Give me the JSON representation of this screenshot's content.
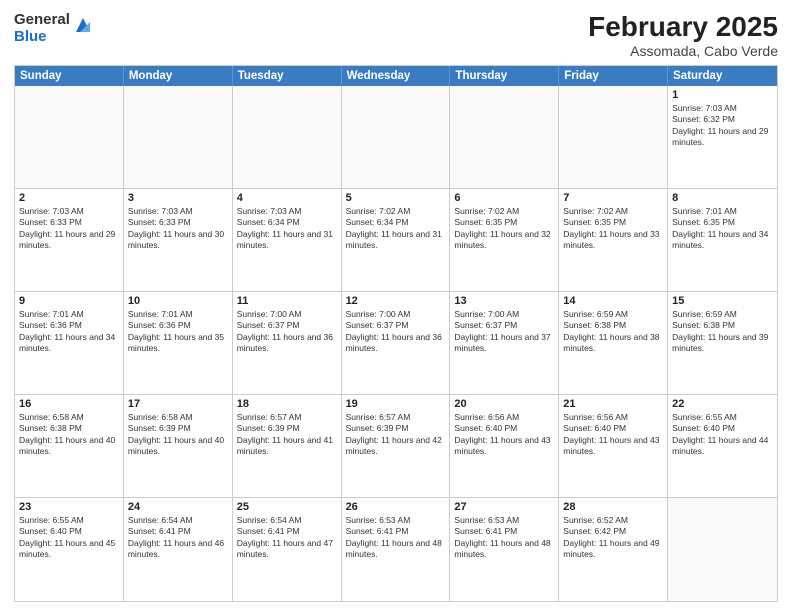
{
  "logo": {
    "general": "General",
    "blue": "Blue"
  },
  "title": "February 2025",
  "location": "Assomada, Cabo Verde",
  "header_days": [
    "Sunday",
    "Monday",
    "Tuesday",
    "Wednesday",
    "Thursday",
    "Friday",
    "Saturday"
  ],
  "weeks": [
    [
      {
        "day": "",
        "text": ""
      },
      {
        "day": "",
        "text": ""
      },
      {
        "day": "",
        "text": ""
      },
      {
        "day": "",
        "text": ""
      },
      {
        "day": "",
        "text": ""
      },
      {
        "day": "",
        "text": ""
      },
      {
        "day": "1",
        "text": "Sunrise: 7:03 AM\nSunset: 6:32 PM\nDaylight: 11 hours and 29 minutes."
      }
    ],
    [
      {
        "day": "2",
        "text": "Sunrise: 7:03 AM\nSunset: 6:33 PM\nDaylight: 11 hours and 29 minutes."
      },
      {
        "day": "3",
        "text": "Sunrise: 7:03 AM\nSunset: 6:33 PM\nDaylight: 11 hours and 30 minutes."
      },
      {
        "day": "4",
        "text": "Sunrise: 7:03 AM\nSunset: 6:34 PM\nDaylight: 11 hours and 31 minutes."
      },
      {
        "day": "5",
        "text": "Sunrise: 7:02 AM\nSunset: 6:34 PM\nDaylight: 11 hours and 31 minutes."
      },
      {
        "day": "6",
        "text": "Sunrise: 7:02 AM\nSunset: 6:35 PM\nDaylight: 11 hours and 32 minutes."
      },
      {
        "day": "7",
        "text": "Sunrise: 7:02 AM\nSunset: 6:35 PM\nDaylight: 11 hours and 33 minutes."
      },
      {
        "day": "8",
        "text": "Sunrise: 7:01 AM\nSunset: 6:35 PM\nDaylight: 11 hours and 34 minutes."
      }
    ],
    [
      {
        "day": "9",
        "text": "Sunrise: 7:01 AM\nSunset: 6:36 PM\nDaylight: 11 hours and 34 minutes."
      },
      {
        "day": "10",
        "text": "Sunrise: 7:01 AM\nSunset: 6:36 PM\nDaylight: 11 hours and 35 minutes."
      },
      {
        "day": "11",
        "text": "Sunrise: 7:00 AM\nSunset: 6:37 PM\nDaylight: 11 hours and 36 minutes."
      },
      {
        "day": "12",
        "text": "Sunrise: 7:00 AM\nSunset: 6:37 PM\nDaylight: 11 hours and 36 minutes."
      },
      {
        "day": "13",
        "text": "Sunrise: 7:00 AM\nSunset: 6:37 PM\nDaylight: 11 hours and 37 minutes."
      },
      {
        "day": "14",
        "text": "Sunrise: 6:59 AM\nSunset: 6:38 PM\nDaylight: 11 hours and 38 minutes."
      },
      {
        "day": "15",
        "text": "Sunrise: 6:59 AM\nSunset: 6:38 PM\nDaylight: 11 hours and 39 minutes."
      }
    ],
    [
      {
        "day": "16",
        "text": "Sunrise: 6:58 AM\nSunset: 6:38 PM\nDaylight: 11 hours and 40 minutes."
      },
      {
        "day": "17",
        "text": "Sunrise: 6:58 AM\nSunset: 6:39 PM\nDaylight: 11 hours and 40 minutes."
      },
      {
        "day": "18",
        "text": "Sunrise: 6:57 AM\nSunset: 6:39 PM\nDaylight: 11 hours and 41 minutes."
      },
      {
        "day": "19",
        "text": "Sunrise: 6:57 AM\nSunset: 6:39 PM\nDaylight: 11 hours and 42 minutes."
      },
      {
        "day": "20",
        "text": "Sunrise: 6:56 AM\nSunset: 6:40 PM\nDaylight: 11 hours and 43 minutes."
      },
      {
        "day": "21",
        "text": "Sunrise: 6:56 AM\nSunset: 6:40 PM\nDaylight: 11 hours and 43 minutes."
      },
      {
        "day": "22",
        "text": "Sunrise: 6:55 AM\nSunset: 6:40 PM\nDaylight: 11 hours and 44 minutes."
      }
    ],
    [
      {
        "day": "23",
        "text": "Sunrise: 6:55 AM\nSunset: 6:40 PM\nDaylight: 11 hours and 45 minutes."
      },
      {
        "day": "24",
        "text": "Sunrise: 6:54 AM\nSunset: 6:41 PM\nDaylight: 11 hours and 46 minutes."
      },
      {
        "day": "25",
        "text": "Sunrise: 6:54 AM\nSunset: 6:41 PM\nDaylight: 11 hours and 47 minutes."
      },
      {
        "day": "26",
        "text": "Sunrise: 6:53 AM\nSunset: 6:41 PM\nDaylight: 11 hours and 48 minutes."
      },
      {
        "day": "27",
        "text": "Sunrise: 6:53 AM\nSunset: 6:41 PM\nDaylight: 11 hours and 48 minutes."
      },
      {
        "day": "28",
        "text": "Sunrise: 6:52 AM\nSunset: 6:42 PM\nDaylight: 11 hours and 49 minutes."
      },
      {
        "day": "",
        "text": ""
      }
    ]
  ]
}
